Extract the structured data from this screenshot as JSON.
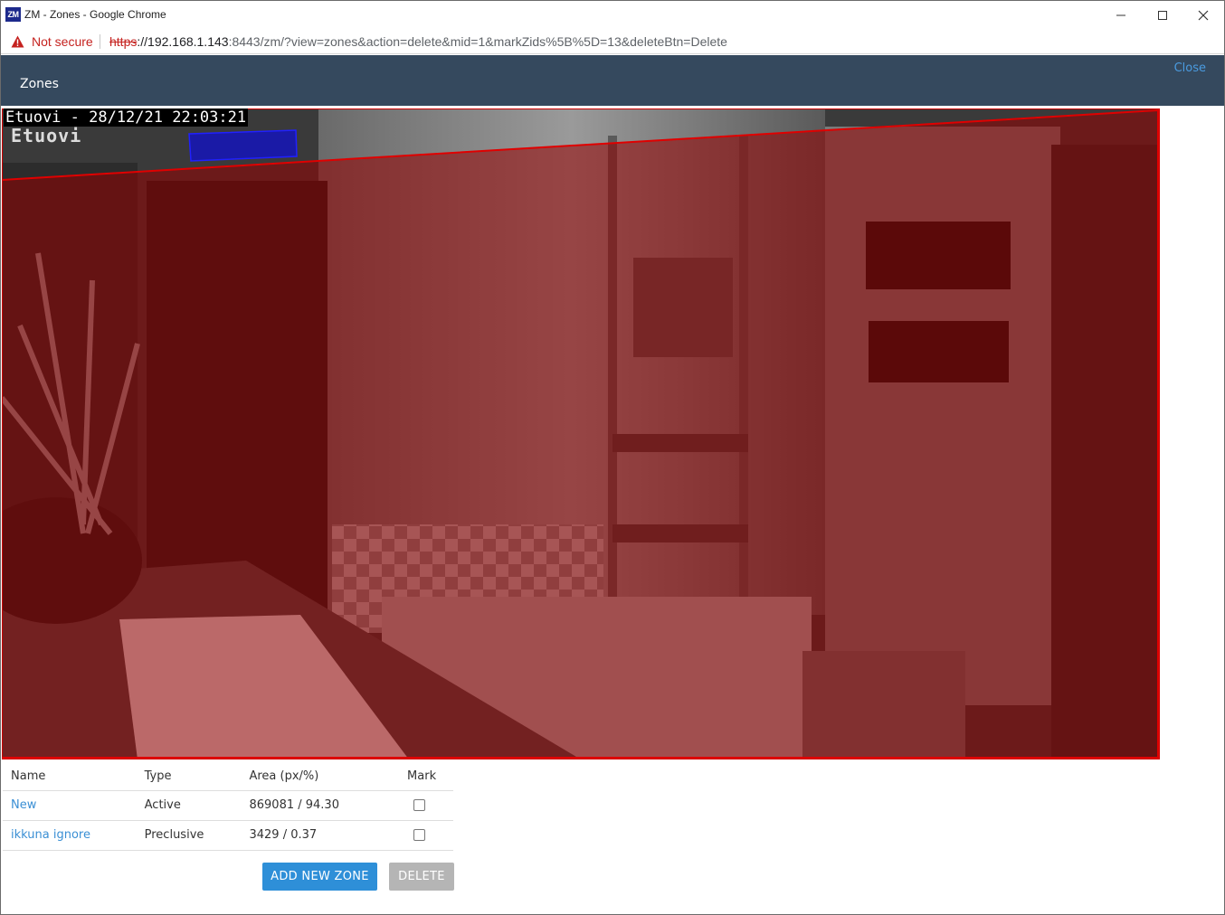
{
  "window": {
    "title": "ZM - Zones - Google Chrome",
    "app_icon_text": "ZM"
  },
  "addressbar": {
    "security_label": "Not secure",
    "url_scheme": "https",
    "url_host": "://192.168.1.143",
    "url_rest": ":8443/zm/?view=zones&action=delete&mid=1&markZids%5B%5D=13&deleteBtn=Delete"
  },
  "header": {
    "title": "Zones",
    "close_label": "Close"
  },
  "camera": {
    "overlay_text": "Etuovi - 28/12/21 22:03:21",
    "camera_name": "Etuovi",
    "active_zone_color": "#cc0000",
    "preclusive_zone_color": "#0000ff"
  },
  "table": {
    "headers": {
      "name": "Name",
      "type": "Type",
      "area": "Area (px/%)",
      "mark": "Mark"
    },
    "rows": [
      {
        "name": "New",
        "type": "Active",
        "area": "869081 / 94.30"
      },
      {
        "name": "ikkuna ignore",
        "type": "Preclusive",
        "area": "3429 / 0.37"
      }
    ]
  },
  "buttons": {
    "add_label": "ADD NEW ZONE",
    "delete_label": "DELETE"
  }
}
